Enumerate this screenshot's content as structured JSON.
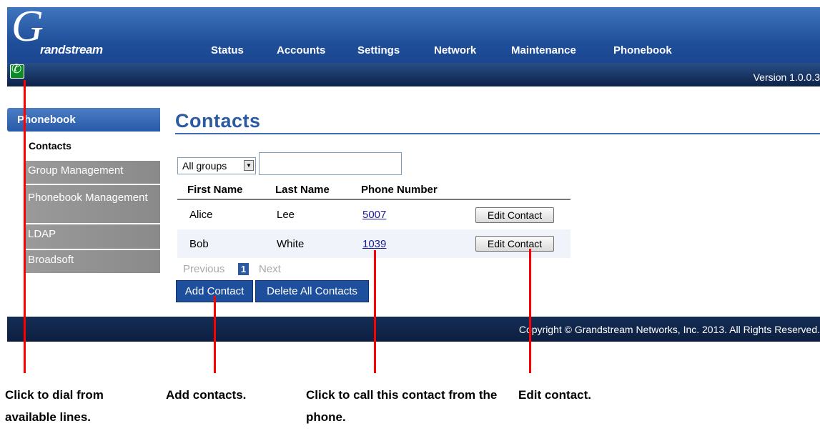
{
  "header": {
    "logo_initial": "G",
    "logo_text": "randstream",
    "nav": [
      {
        "label": "Status"
      },
      {
        "label": "Accounts"
      },
      {
        "label": "Settings"
      },
      {
        "label": "Network"
      },
      {
        "label": "Maintenance"
      },
      {
        "label": "Phonebook"
      }
    ],
    "version": "Version 1.0.0.3",
    "dial_icon": "phone-handset-icon",
    "dial_glyph": "✆"
  },
  "sidebar": {
    "section": "Phonebook",
    "current": "Contacts",
    "items": [
      {
        "label": "Group Management"
      },
      {
        "label": "Phonebook Management"
      },
      {
        "label": "LDAP"
      },
      {
        "label": "Broadsoft"
      }
    ]
  },
  "main": {
    "title": "Contacts",
    "group_filter": {
      "selected": "All groups",
      "arrow_icon": "chevron-down-icon",
      "arrow_glyph": "▼"
    },
    "search": {
      "value": ""
    },
    "columns": [
      "First Name",
      "Last Name",
      "Phone Number"
    ],
    "rows": [
      {
        "first": "Alice",
        "last": "Lee",
        "phone": "5007",
        "action": "Edit Contact"
      },
      {
        "first": "Bob",
        "last": "White",
        "phone": "1039",
        "action": "Edit Contact"
      }
    ],
    "pagination": {
      "previous": "Previous",
      "current": "1",
      "next": "Next"
    },
    "add_button": "Add Contact",
    "delete_all_button": "Delete All Contacts"
  },
  "footer": {
    "copyright": "Copyright © Grandstream Networks, Inc. 2013. All Rights Reserved."
  },
  "annotations": {
    "dial": "Click to dial from available lines.",
    "add": "Add contacts.",
    "call": "Click to call this contact from the phone.",
    "edit": "Edit contact.",
    "line_color": "#ff0000"
  }
}
